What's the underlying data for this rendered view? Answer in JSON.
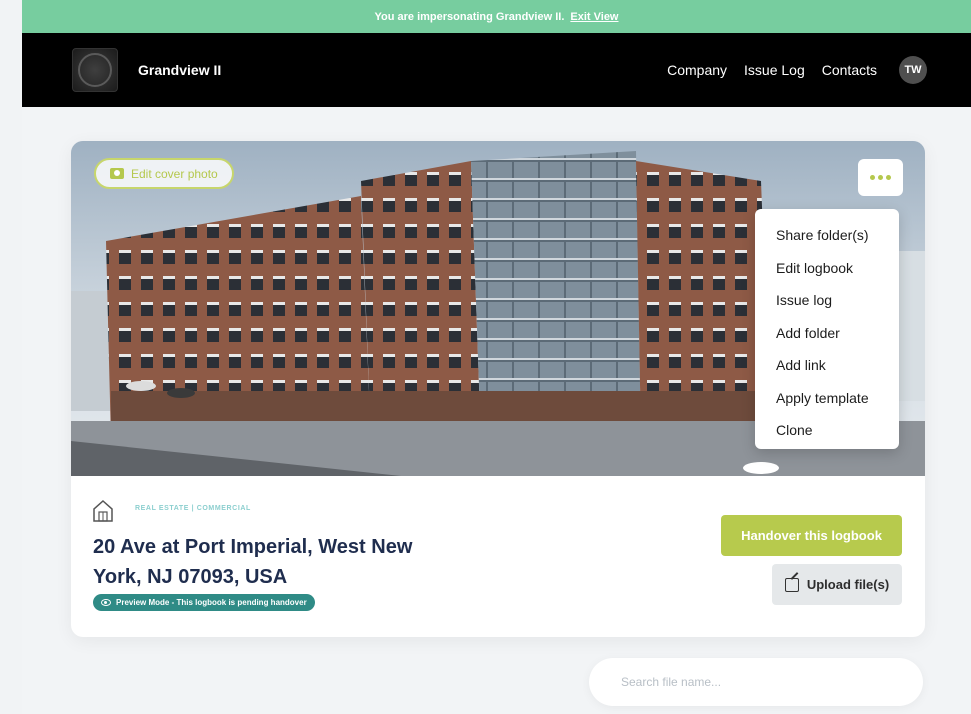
{
  "impersonation": {
    "message": "You are impersonating Grandview II.",
    "exit_label": "Exit View"
  },
  "header": {
    "brand": "Grandview II",
    "nav": [
      "Company",
      "Issue Log",
      "Contacts"
    ],
    "avatar_initials": "TW"
  },
  "cover": {
    "edit_label": "Edit cover photo",
    "edit_icon": "camera-icon",
    "more_icon": "more-dots-icon"
  },
  "menu": {
    "items": [
      "Share folder(s)",
      "Edit logbook",
      "Issue log",
      "Add folder",
      "Add link",
      "Apply template",
      "Clone"
    ]
  },
  "logbook": {
    "category": "REAL ESTATE | COMMERCIAL",
    "address_line1": "20 Ave at Port Imperial, West New",
    "address_line2": "York, NJ 07093, USA",
    "preview_badge": "Preview Mode - This logbook is pending handover",
    "type_icon": "house-icon"
  },
  "actions": {
    "handover_label": "Handover this logbook",
    "upload_label": "Upload file(s)",
    "upload_icon": "upload-icon"
  },
  "search": {
    "placeholder": "Search file name..."
  },
  "colors": {
    "impersonation_bar": "#77cd9f",
    "nav_bg": "#000000",
    "accent": "#b7ca4d",
    "badge": "#2f8b86",
    "heading": "#1f2d4e"
  }
}
